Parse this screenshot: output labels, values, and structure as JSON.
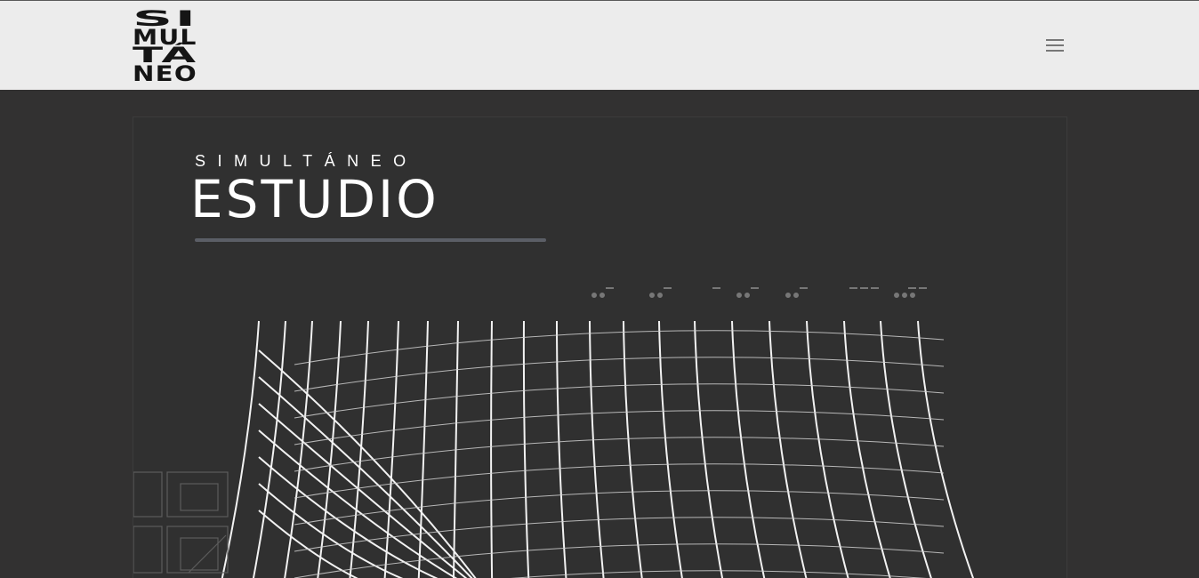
{
  "header": {
    "logo_lines": [
      "SI",
      "MUL",
      "TÁ",
      "NEO"
    ],
    "menu_icon": "hamburger-menu-icon",
    "background": "#ececec"
  },
  "hero": {
    "overline": "SIMULTÁNEO",
    "title": "ESTUDIO",
    "background": "#303030",
    "text_color": "#ffffff",
    "underline_color": "#5b5e66"
  }
}
